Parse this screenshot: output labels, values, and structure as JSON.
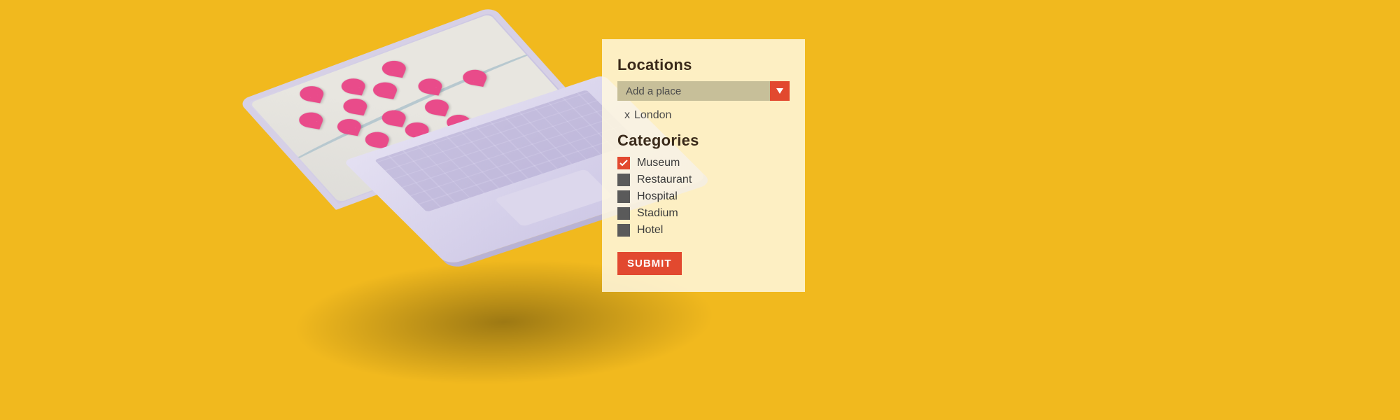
{
  "panel": {
    "locations_title": "Locations",
    "dropdown_placeholder": "Add a place",
    "selected_place": {
      "remove_symbol": "x",
      "name": "London"
    },
    "categories_title": "Categories",
    "categories": [
      {
        "label": "Museum",
        "checked": true
      },
      {
        "label": "Restaurant",
        "checked": false
      },
      {
        "label": "Hospital",
        "checked": false
      },
      {
        "label": "Stadium",
        "checked": false
      },
      {
        "label": "Hotel",
        "checked": false
      }
    ],
    "submit_label": "SUBMIT"
  },
  "colors": {
    "background": "#f1b91e",
    "accent": "#e2492f",
    "pin": "#e94b8a",
    "panel_bg": "rgba(255,248,225,0.85)"
  }
}
